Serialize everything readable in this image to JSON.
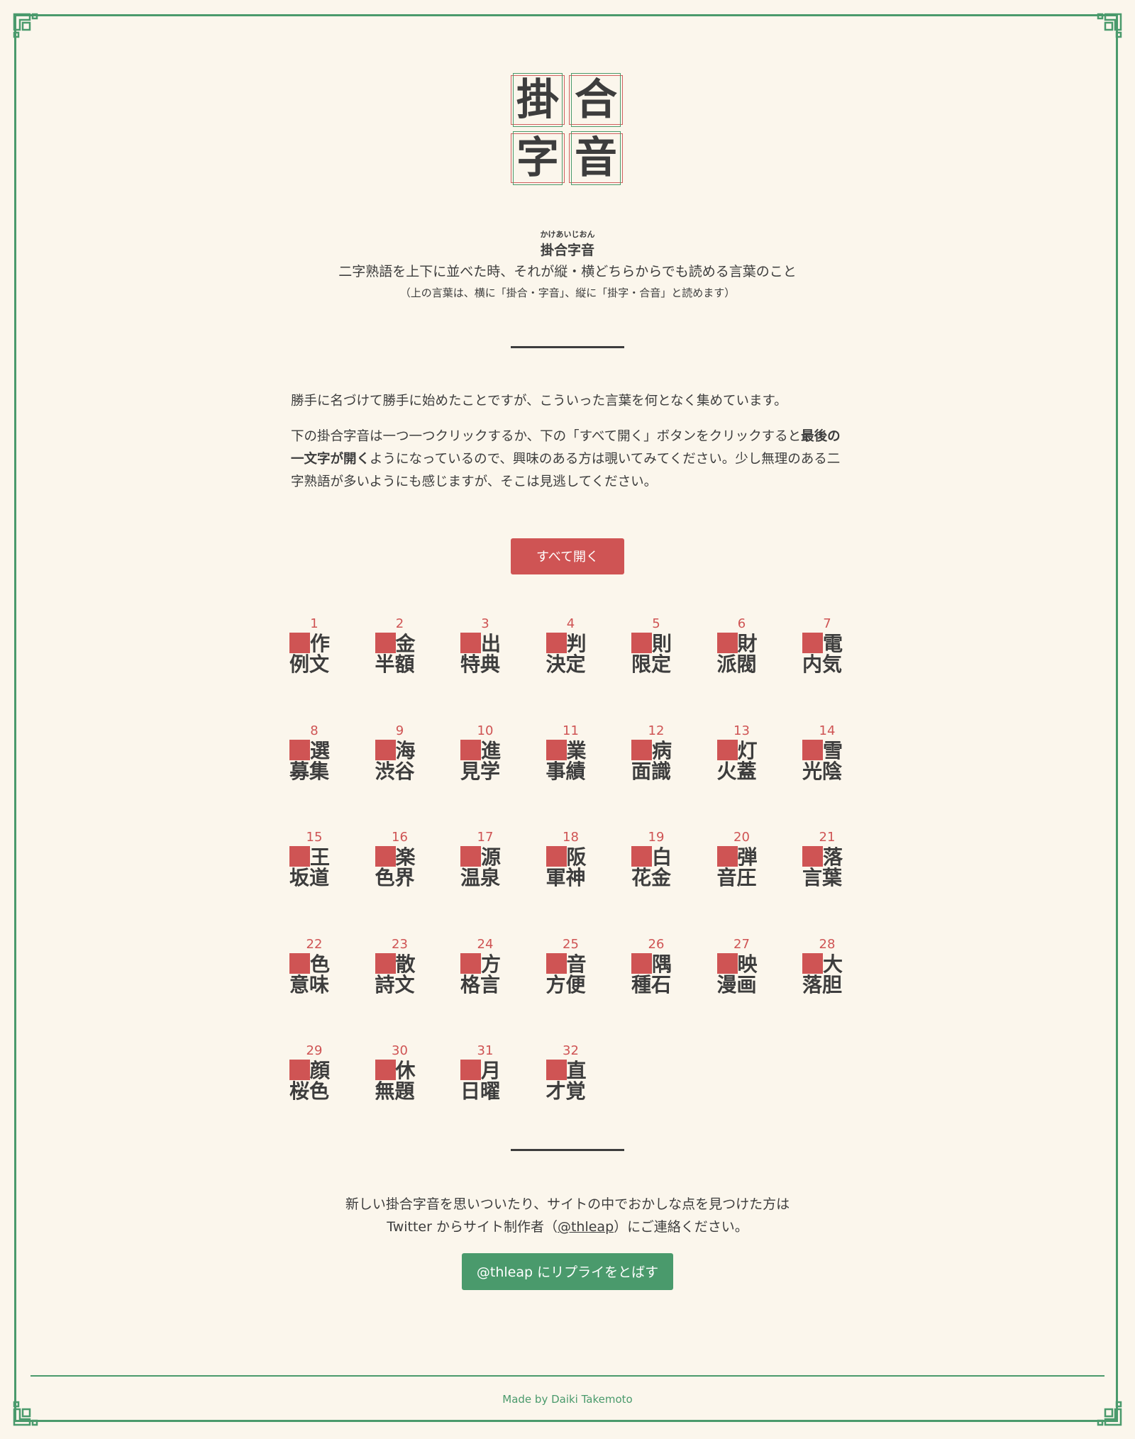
{
  "logo": {
    "chars": [
      "掛",
      "合",
      "字",
      "音"
    ]
  },
  "header": {
    "ruby": "かけあいじおん",
    "title": "掛合字音",
    "definition": "二字熟語を上下に並べた時、それが縦・横どちらからでも読める言葉のこと",
    "note": "（上の言葉は、横に「掛合・字音」、縦に「掛字・合音」と読めます）"
  },
  "intro": {
    "p1": "勝手に名づけて勝手に始めたことですが、こういった言葉を何となく集めています。",
    "p2_start": "下の掛合字音は一つ一つクリックするか、下の「すべて開く」ボタンをクリックすると",
    "p2_bold": "最後の一文字が開く",
    "p2_end": "ようになっているので、興味のある方は覗いてみてください。少し無理のある二字熟語が多いようにも感じますが、そこは見逃してください。"
  },
  "open_all_label": "すべて開く",
  "puzzles": [
    {
      "num": "1",
      "top": "作",
      "bottom": "例文"
    },
    {
      "num": "2",
      "top": "金",
      "bottom": "半額"
    },
    {
      "num": "3",
      "top": "出",
      "bottom": "特典"
    },
    {
      "num": "4",
      "top": "判",
      "bottom": "決定"
    },
    {
      "num": "5",
      "top": "則",
      "bottom": "限定"
    },
    {
      "num": "6",
      "top": "財",
      "bottom": "派閥"
    },
    {
      "num": "7",
      "top": "電",
      "bottom": "内気"
    },
    {
      "num": "8",
      "top": "選",
      "bottom": "募集"
    },
    {
      "num": "9",
      "top": "海",
      "bottom": "渋谷"
    },
    {
      "num": "10",
      "top": "進",
      "bottom": "見学"
    },
    {
      "num": "11",
      "top": "業",
      "bottom": "事績"
    },
    {
      "num": "12",
      "top": "病",
      "bottom": "面識"
    },
    {
      "num": "13",
      "top": "灯",
      "bottom": "火蓋"
    },
    {
      "num": "14",
      "top": "雪",
      "bottom": "光陰"
    },
    {
      "num": "15",
      "top": "王",
      "bottom": "坂道"
    },
    {
      "num": "16",
      "top": "楽",
      "bottom": "色界"
    },
    {
      "num": "17",
      "top": "源",
      "bottom": "温泉"
    },
    {
      "num": "18",
      "top": "阪",
      "bottom": "軍神"
    },
    {
      "num": "19",
      "top": "白",
      "bottom": "花金"
    },
    {
      "num": "20",
      "top": "弾",
      "bottom": "音圧"
    },
    {
      "num": "21",
      "top": "落",
      "bottom": "言葉"
    },
    {
      "num": "22",
      "top": "色",
      "bottom": "意味"
    },
    {
      "num": "23",
      "top": "散",
      "bottom": "詩文"
    },
    {
      "num": "24",
      "top": "方",
      "bottom": "格言"
    },
    {
      "num": "25",
      "top": "音",
      "bottom": "方便"
    },
    {
      "num": "26",
      "top": "隅",
      "bottom": "種石"
    },
    {
      "num": "27",
      "top": "映",
      "bottom": "漫画"
    },
    {
      "num": "28",
      "top": "大",
      "bottom": "落胆"
    },
    {
      "num": "29",
      "top": "顔",
      "bottom": "桜色"
    },
    {
      "num": "30",
      "top": "休",
      "bottom": "無題"
    },
    {
      "num": "31",
      "top": "月",
      "bottom": "日曜"
    },
    {
      "num": "32",
      "top": "直",
      "bottom": "才覚"
    }
  ],
  "footer": {
    "line1": "新しい掛合字音を思いついたり、サイトの中でおかしな点を見つけた方は",
    "line2_start": "Twitter からサイト制作者（",
    "handle": "@thleap",
    "line2_end": "）にご連絡ください。",
    "reply_label": "@thleap にリプライをとばす",
    "credit": "Made by Daiki Takemoto"
  },
  "colors": {
    "accent_red": "#cf5454",
    "accent_green": "#4a9a6c",
    "background": "#fbf6ec",
    "text": "#3d3d3d"
  }
}
